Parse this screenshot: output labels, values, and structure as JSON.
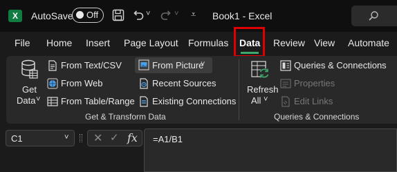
{
  "titlebar": {
    "autosave_label": "AutoSave",
    "autosave_state": "Off",
    "document_title": "Book1  -  Excel",
    "logo_letter": "X",
    "icons": [
      "excel-logo-icon",
      "save-icon",
      "undo-icon",
      "redo-icon",
      "customize-dropdown-icon",
      "search-icon"
    ]
  },
  "menu": {
    "tabs": [
      "File",
      "Home",
      "Insert",
      "Page Layout",
      "Formulas",
      "Data",
      "Review",
      "View",
      "Automate"
    ],
    "active_tab": "Data"
  },
  "ribbon": {
    "get_data": {
      "line1": "Get",
      "line2": "Data",
      "caret": "˅"
    },
    "from_text_csv": "From Text/CSV",
    "from_web": "From Web",
    "from_table_range": "From Table/Range",
    "from_picture": "From Picture",
    "from_picture_caret": "˅",
    "recent_sources": "Recent Sources",
    "existing_connections": "Existing Connections",
    "group1_label": "Get & Transform Data",
    "refresh": {
      "line1": "Refresh",
      "line2": "All",
      "caret": "˅"
    },
    "queries_connections": "Queries & Connections",
    "properties": "Properties",
    "edit_links": "Edit Links",
    "group2_label": "Queries & Connections"
  },
  "formula_bar": {
    "name_box": "C1",
    "name_box_caret": "˅",
    "fx_label": "fx",
    "formula": "=A1/B1"
  },
  "colors": {
    "accent_green": "#3fa86c",
    "highlight_red": "#e00000",
    "excel_green": "#107c41"
  }
}
